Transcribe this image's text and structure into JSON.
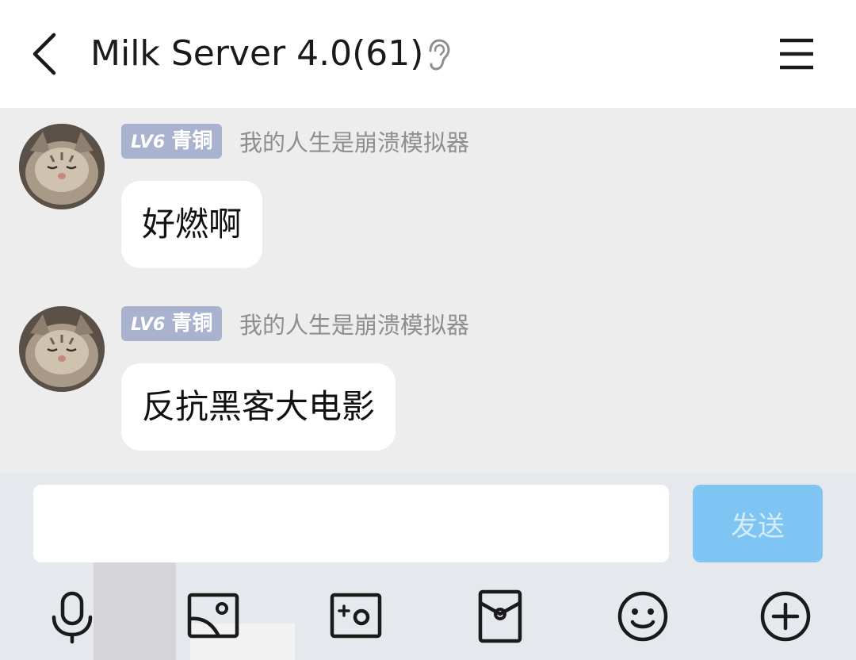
{
  "header": {
    "title": "Milk Server 4.0(61)",
    "icons": [
      "back-arrow-icon",
      "ear-icon",
      "menu-icon"
    ]
  },
  "messages": [
    {
      "level": "LV6",
      "rank": "青铜",
      "nickname": "我的人生是崩溃模拟器",
      "text": "好燃啊"
    },
    {
      "level": "LV6",
      "rank": "青铜",
      "nickname": "我的人生是崩溃模拟器",
      "text": "反抗黑客大电影"
    }
  ],
  "composer": {
    "input_value": "",
    "send_label": "发送",
    "tools": [
      "microphone-icon",
      "image-icon",
      "camera-icon",
      "red-packet-icon",
      "emoji-icon",
      "plus-icon"
    ]
  },
  "colors": {
    "badge": "#a9b3cf",
    "send_button": "#7fc5f3",
    "composer_bg": "#e5e8ed",
    "chat_bg": "#ededed"
  }
}
